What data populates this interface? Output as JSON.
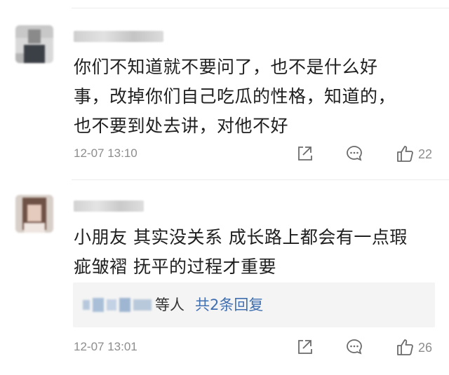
{
  "comments": [
    {
      "text": "你们不知道就不要问了，也不是什么好\n事，改掉你们自己吃瓜的性格，知道的，\n也不要到处去讲，对他不好",
      "time": "12-07 13:10",
      "likes": "22"
    },
    {
      "text": "小朋友 其实没关系 成长路上都会有一点瑕\n疵皱褶 抚平的过程才重要",
      "reply_prefix": "等人",
      "reply_link": "共2条回复",
      "time": "12-07 13:01",
      "likes": "26"
    }
  ],
  "icons": {
    "share": "share-icon",
    "comment": "comment-icon",
    "like": "thumbs-up-icon"
  },
  "colors": {
    "link": "#3f6fb0",
    "meta": "#8d8d8d",
    "reply_bg": "#f4f4f4"
  }
}
